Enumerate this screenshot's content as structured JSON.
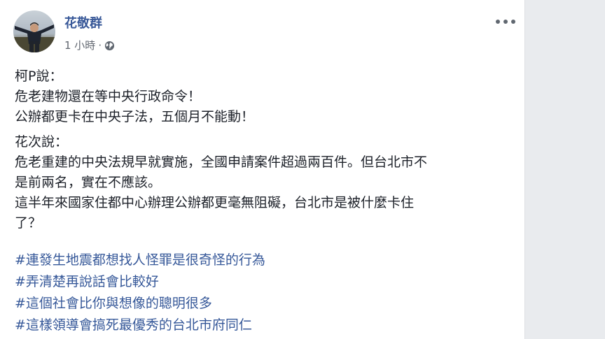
{
  "post": {
    "author": "花敬群",
    "time": "1 小時",
    "dot": "·",
    "icons": {
      "privacy": "globe-icon",
      "menu": "more-options-icon"
    },
    "colors": {
      "link": "#365899",
      "author": "#385898",
      "text": "#1d2129",
      "meta": "#616770"
    },
    "paragraphs": [
      {
        "lines": [
          "柯P說：",
          "危老建物還在等中央行政命令！",
          "公辦都更卡在中央子法，五個月不能動！"
        ]
      },
      {
        "lines": [
          "花次說：",
          "危老重建的中央法規早就實施，全國申請案件超過兩百件。但台北市不",
          "是前兩名，實在不應該。",
          "這半年來國家住都中心辦理公辦都更毫無阻礙，台北市是被什麼卡住",
          "了？"
        ]
      }
    ],
    "hashtags": [
      "#連發生地震都想找人怪罪是很奇怪的行為",
      "#弄清楚再說話會比較好",
      "#這個社會比你與想像的聰明很多",
      "#這樣領導會搞死最優秀的台北市府同仁"
    ]
  }
}
